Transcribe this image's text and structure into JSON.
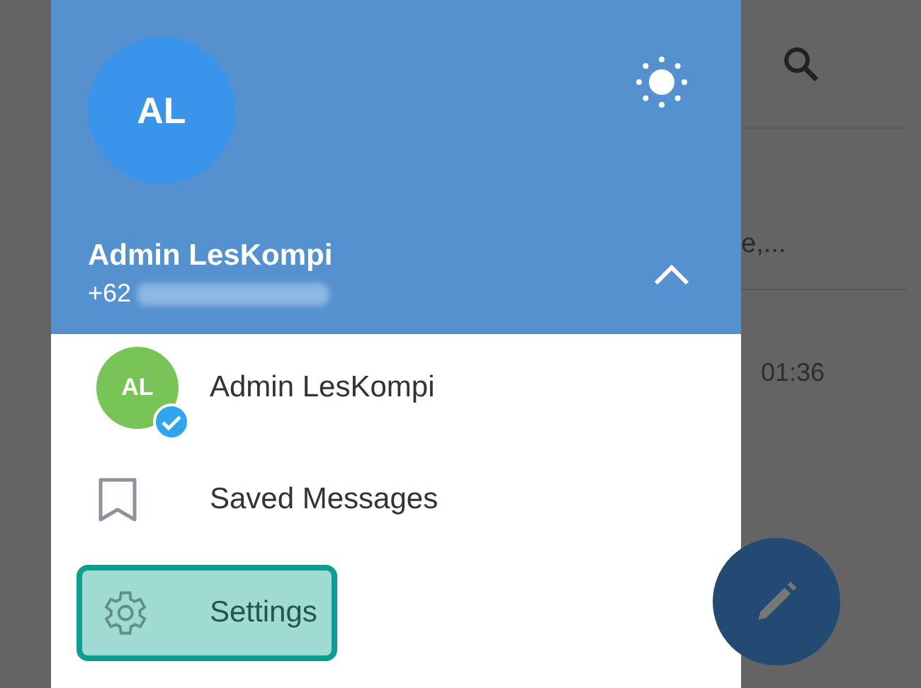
{
  "drawer": {
    "header": {
      "avatar_initials": "AL",
      "name": "Admin LesKompi",
      "phone": "+62",
      "phone_redacted": true,
      "expanded": true
    },
    "items": [
      {
        "kind": "account",
        "label": "Admin LesKompi",
        "initials": "AL",
        "selected": false
      },
      {
        "kind": "saved",
        "label": "Saved Messages",
        "selected": false
      },
      {
        "kind": "settings",
        "label": "Settings",
        "selected": true
      }
    ]
  },
  "background": {
    "preview": "e,...",
    "time": "01:36"
  }
}
